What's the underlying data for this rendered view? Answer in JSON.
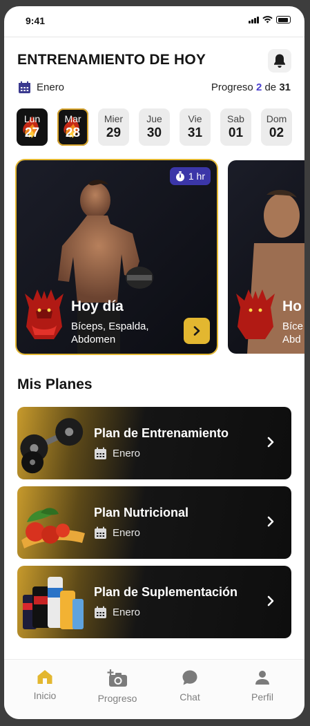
{
  "status": {
    "time": "9:41"
  },
  "header": {
    "title": "ENTRENAMIENTO DE HOY",
    "month": "Enero",
    "progress_prefix": "Progreso",
    "progress_current": "2",
    "progress_sep": "de",
    "progress_total": "31"
  },
  "days": [
    {
      "name": "Lun",
      "num": "27"
    },
    {
      "name": "Mar",
      "num": "28"
    },
    {
      "name": "Mier",
      "num": "29"
    },
    {
      "name": "Jue",
      "num": "30"
    },
    {
      "name": "Vie",
      "num": "31"
    },
    {
      "name": "Sab",
      "num": "01"
    },
    {
      "name": "Dom",
      "num": "02"
    }
  ],
  "workouts": [
    {
      "duration": "1 hr",
      "title": "Hoy día",
      "subtitle": "Bíceps, Espalda, Abdomen"
    },
    {
      "title": "Ho",
      "subtitle": "Bíce Abd"
    }
  ],
  "plans_section": "Mis Planes",
  "plans": [
    {
      "title": "Plan de Entrenamiento",
      "month": "Enero",
      "image": "dumbbells"
    },
    {
      "title": "Plan Nutricional",
      "month": "Enero",
      "image": "vegetables-tape"
    },
    {
      "title": "Plan de Suplementación",
      "month": "Enero",
      "image": "supplements"
    }
  ],
  "tabs": [
    {
      "label": "Inicio",
      "icon": "home-icon"
    },
    {
      "label": "Progreso",
      "icon": "add-photo-icon"
    },
    {
      "label": "Chat",
      "icon": "chat-icon"
    },
    {
      "label": "Perfil",
      "icon": "person-icon"
    }
  ],
  "colors": {
    "accent": "#E3B730",
    "progress_highlight": "#4A3FCF",
    "timer_badge": "#3B36A8",
    "nav_active": "#E3B730"
  }
}
